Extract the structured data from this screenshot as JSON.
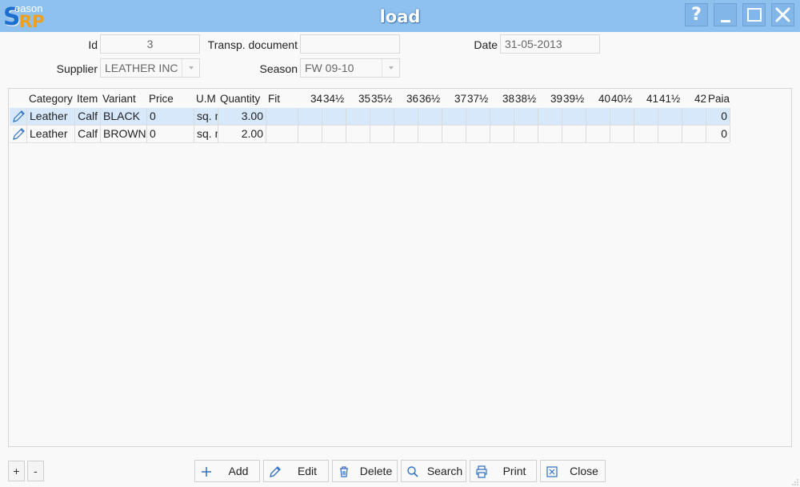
{
  "window": {
    "title": "load",
    "logo_season": "eason",
    "logo_s": "S",
    "logo_rp": "RP",
    "help_label": "?"
  },
  "form": {
    "id_label": "Id",
    "id_value": "3",
    "transp_label": "Transp. document",
    "transp_value": "",
    "date_label": "Date",
    "date_value": "31-05-2013",
    "supplier_label": "Supplier",
    "supplier_value": "LEATHER INC",
    "season_label": "Season",
    "season_value": "FW 09-10"
  },
  "grid": {
    "headers": {
      "category": "Category",
      "item": "Item",
      "variant": "Variant",
      "price": "Price",
      "um": "U.M",
      "quantity": "Quantity",
      "fit": "Fit",
      "s34": "34",
      "s34h": "34½",
      "s35": "35",
      "s35h": "35½",
      "s36": "36",
      "s36h": "36½",
      "s37": "37",
      "s37h": "37½",
      "s38": "38",
      "s38h": "38½",
      "s39": "39",
      "s39h": "39½",
      "s40": "40",
      "s40h": "40½",
      "s41": "41",
      "s41h": "41½",
      "s42": "42",
      "paia": "Paia"
    },
    "rows": [
      {
        "category": "Leather",
        "item": "Calf",
        "variant": "BLACK",
        "price": "0",
        "um": "sq. m",
        "quantity": "3.00",
        "fit": "",
        "paia": "0"
      },
      {
        "category": "Leather",
        "item": "Calf",
        "variant": "BROWN",
        "price": "0",
        "um": "sq. m",
        "quantity": "2.00",
        "fit": "",
        "paia": "0"
      }
    ]
  },
  "footer": {
    "plus_label": "+",
    "minus_label": "-",
    "add_label": "Add",
    "edit_label": "Edit",
    "delete_label": "Delete",
    "search_label": "Search",
    "print_label": "Print",
    "close_label": "Close"
  }
}
